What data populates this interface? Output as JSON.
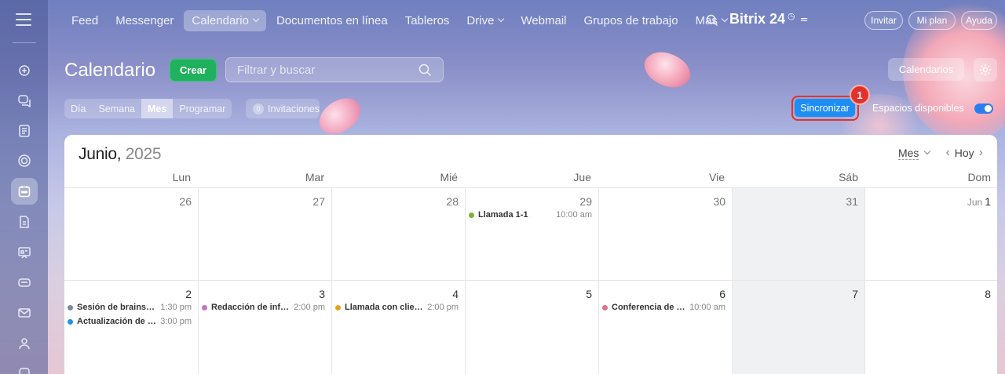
{
  "nav": {
    "items": [
      "Feed",
      "Messenger",
      "Calendario",
      "Documentos en línea",
      "Tableros",
      "Drive",
      "Webmail",
      "Grupos de trabajo",
      "Más"
    ],
    "brand": "Bitrix 24",
    "invite": "Invitar",
    "plan": "Mi plan",
    "help": "Ayuda"
  },
  "header": {
    "title": "Calendario",
    "create": "Crear",
    "filter_placeholder": "Filtrar y buscar",
    "calendars": "Calendarios"
  },
  "views": [
    "Día",
    "Semana",
    "Mes",
    "Programar"
  ],
  "invitations": {
    "count": "0",
    "label": "Invitaciones"
  },
  "sync": {
    "label": "Sincronizar",
    "badge": "1"
  },
  "spaces": {
    "label": "Espacios disponibles",
    "enabled": true
  },
  "calendar": {
    "month": "Junio,",
    "year": "2025",
    "mode": "Mes",
    "today": "Hoy",
    "days": [
      "Lun",
      "Mar",
      "Mié",
      "Jue",
      "Vie",
      "Sáb",
      "Dom"
    ],
    "week1": [
      "26",
      "27",
      "28",
      "29",
      "30",
      "31",
      "1"
    ],
    "week1_sun_prefix": "Jun",
    "week2": [
      "2",
      "3",
      "4",
      "5",
      "6",
      "7",
      "8"
    ],
    "events": [
      {
        "name": "Llamada 1-1",
        "time": "10:00 am",
        "color": "#7fb135"
      },
      {
        "name": "Sesión de brainstorming",
        "time": "1:30 pm",
        "color": "#7d8a98"
      },
      {
        "name": "Actualización de proyecto",
        "time": "3:00 pm",
        "color": "#1e94e6"
      },
      {
        "name": "Redacción de informe",
        "time": "2:00 pm",
        "color": "#c176c4"
      },
      {
        "name": "Llamada con cliente",
        "time": "2:00 pm",
        "color": "#e2a41b"
      },
      {
        "name": "Conferencia de ventas",
        "time": "10:00 am",
        "color": "#e2708f"
      }
    ]
  },
  "colors": {
    "accent": "#1e8ef2",
    "create": "#1fb15d",
    "highlight": "#e2322d"
  }
}
